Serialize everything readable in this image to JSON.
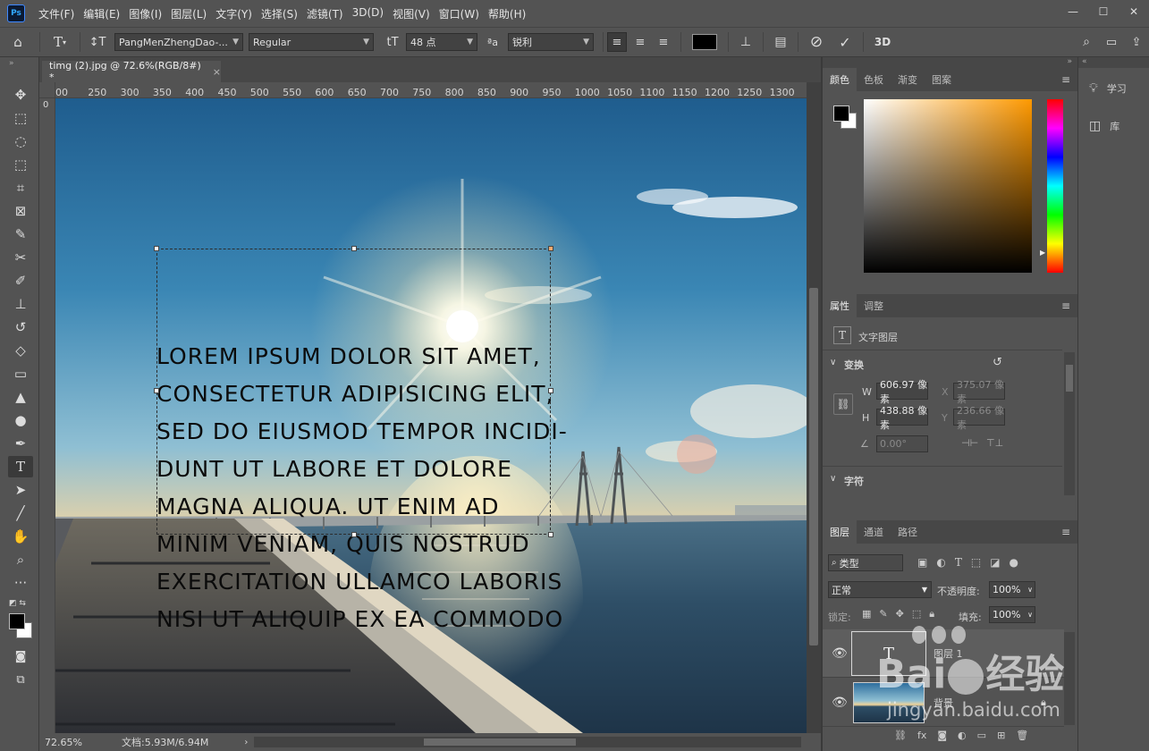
{
  "app": {
    "logo": "Ps",
    "menus": [
      "文件(F)",
      "编辑(E)",
      "图像(I)",
      "图层(L)",
      "文字(Y)",
      "选择(S)",
      "滤镜(T)",
      "3D(D)",
      "视图(V)",
      "窗口(W)",
      "帮助(H)"
    ],
    "minimize": "—",
    "maximize": "☐",
    "close": "✕"
  },
  "options": {
    "font_family": "PangMenZhengDao-...",
    "font_style": "Regular",
    "font_size": "48 点",
    "aa_label": "ªa",
    "aa_mode": "锐利",
    "color_swatch": "#000000",
    "cancel": "⊘",
    "commit": "✓",
    "three_d": "3D"
  },
  "document": {
    "tab_title": "timg (2).jpg @ 72.6%(RGB/8#) *",
    "zoom": "72.65%",
    "doc_info": "文档:5.93M/6.94M",
    "ruler_ticks": [
      "00",
      "250",
      "300",
      "350",
      "400",
      "450",
      "500",
      "550",
      "600",
      "650",
      "700",
      "750",
      "800",
      "850",
      "900",
      "950",
      "1000",
      "1050",
      "1100",
      "1150",
      "1200",
      "1250",
      "1300"
    ],
    "text_lines": [
      "LOREM IPSUM DOLOR SIT AMET,",
      "CONSECTETUR ADIPISICING ELIT,",
      "SED DO EIUSMOD TEMPOR INCIDI-",
      "DUNT UT LABORE ET DOLORE",
      "MAGNA ALIQUA. UT ENIM AD",
      "MINIM VENIAM, QUIS NOSTRUD",
      "EXERCITATION ULLAMCO LABORIS",
      "NISI UT ALIQUIP EX EA COMMODO"
    ]
  },
  "color_panel": {
    "tabs": [
      "颜色",
      "色板",
      "渐变",
      "图案"
    ],
    "foreground": "#000000",
    "background": "#ffffff",
    "hue": "#ff9900"
  },
  "properties": {
    "tabs": [
      "属性",
      "调整"
    ],
    "layer_type": "文字图层",
    "transform_title": "变换",
    "w_label": "W",
    "w_value": "606.97 像素",
    "x_label": "X",
    "x_value": "375.07 像素",
    "h_label": "H",
    "h_value": "438.88 像素",
    "y_label": "Y",
    "y_value": "236.66 像素",
    "angle_value": "0.00°",
    "char_title": "字符"
  },
  "layers": {
    "tabs": [
      "图层",
      "通道",
      "路径"
    ],
    "filter_label": "类型",
    "blend_mode": "正常",
    "opacity_label": "不透明度:",
    "opacity_value": "100%",
    "lock_label": "锁定:",
    "fill_label": "填充:",
    "fill_value": "100%",
    "items": [
      {
        "name": "图层 1"
      },
      {
        "name": "背景"
      }
    ]
  },
  "side": {
    "learn": "学习",
    "library": "库"
  },
  "watermark": {
    "text1": "Bai",
    "text2": "经验",
    "sub": "jingyan.baidu.com"
  }
}
